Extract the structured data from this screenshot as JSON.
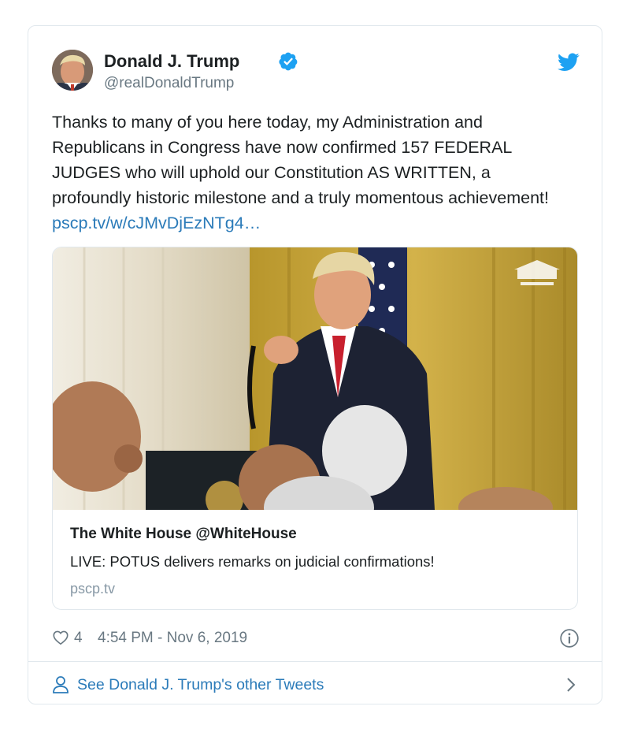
{
  "tweet": {
    "author_name": "Donald J. Trump",
    "author_handle": "@realDonaldTrump",
    "text": "Thanks to many of you here today, my Administration and Republicans in Congress have now confirmed 157 FEDERAL JUDGES who will uphold our Constitution AS WRITTEN, a profoundly historic milestone and a truly momentous achievement!",
    "link_text": "pscp.tv/w/cJMvDjEzNTg4…",
    "like_count": "4",
    "timestamp": "4:54 PM - Nov 6, 2019"
  },
  "card": {
    "title": "The White House @WhiteHouse",
    "description": "LIVE: POTUS delivers remarks on judicial confirmations!",
    "domain": "pscp.tv"
  },
  "footer": {
    "link_label": "See Donald J. Trump's other Tweets"
  },
  "colors": {
    "link": "#2b7bb9",
    "verified": "#1da1f2",
    "muted": "#697882",
    "border": "#e1e8ed"
  },
  "icons": {
    "verified": "verified-badge-icon",
    "brand": "twitter-bird-icon",
    "like": "heart-icon",
    "info": "info-icon",
    "user": "user-icon",
    "chevron": "chevron-right-icon"
  }
}
